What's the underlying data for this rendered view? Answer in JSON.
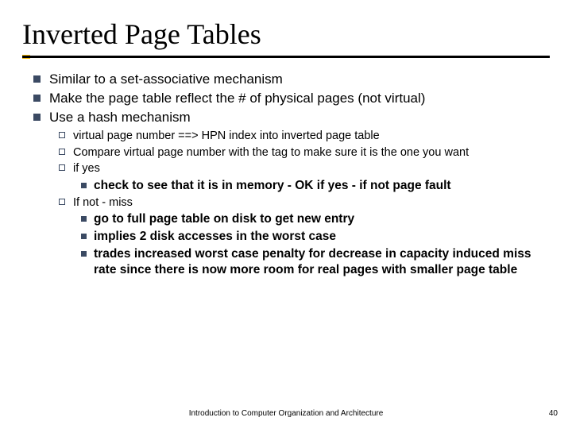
{
  "title": "Inverted Page Tables",
  "bullets": {
    "b0": "Similar to a set-associative mechanism",
    "b1": "Make the page table reflect the # of physical pages (not virtual)",
    "b2": "Use a hash mechanism",
    "s0": "virtual page number ==> HPN index into inverted page table",
    "s1": "Compare virtual page number with the tag to make sure it is the one you want",
    "s2": "if yes",
    "s2a": "check to see that it is in memory - OK if yes - if not page fault",
    "s3": "If not - miss",
    "s3a": "go to full page table on disk to get new entry",
    "s3b": "implies 2 disk accesses in the worst case",
    "s3c": "trades increased worst case penalty for decrease in capacity induced miss rate since there is now more room for real pages with smaller page table"
  },
  "footer": {
    "text": "Introduction to Computer Organization and Architecture",
    "page": "40"
  }
}
